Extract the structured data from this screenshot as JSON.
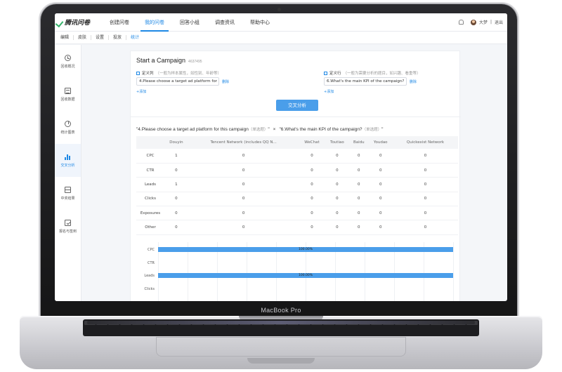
{
  "device": {
    "label": "MacBook Pro"
  },
  "header": {
    "logo_text": "腾讯问卷",
    "nav": [
      "创建问卷",
      "我的问卷",
      "回答小组",
      "调查资讯",
      "帮助中心"
    ],
    "active_nav": 1,
    "user_name": "大梦",
    "logout_label": "退出"
  },
  "subnav": {
    "items": [
      "编辑",
      "皮肤",
      "设置",
      "投放",
      "统计"
    ],
    "active": 4
  },
  "sidebar": {
    "items": [
      {
        "label": "回收概况",
        "icon": "clock-icon"
      },
      {
        "label": "回收数据",
        "icon": "document-icon"
      },
      {
        "label": "统计图表",
        "icon": "pie-chart-icon"
      },
      {
        "label": "交叉分析",
        "icon": "bar-chart-icon"
      },
      {
        "label": "中奖结果",
        "icon": "gift-icon"
      },
      {
        "label": "报名与签到",
        "icon": "signup-icon"
      }
    ],
    "active": 3
  },
  "survey": {
    "title": "Start a Campaign",
    "id": "4637495",
    "custom_col_label": "定义列",
    "custom_col_hint": "（一般为样本属性，如性别、年龄等）",
    "custom_col_value": "4.Please choose a target ad platform for",
    "custom_row_label": "定义行",
    "custom_row_hint": "（一般为需要分析的题目，如兴趣、看重等）",
    "custom_row_value": "6.What's the main KPI of the campaign?",
    "delete_label": "删除",
    "add_label": "+添加",
    "cross_button": "交叉分析"
  },
  "crosstab": {
    "q1": "\"4.Please choose a target ad platform for this campaign",
    "q1_tag": "（单选题）",
    "q1_end": "\"",
    "times": "×",
    "q2": "\"6.What's the main KPI of the campaign?",
    "q2_tag": "（单选题）",
    "q2_end": "\"",
    "columns": [
      "",
      "Douyin",
      "Tencent Network (includes QQ N...",
      "WeChat",
      "Toutiao",
      "Baidu",
      "Youdao",
      "Quickexist Network"
    ],
    "rows": [
      [
        "CPC",
        "1",
        "0",
        "0",
        "0",
        "0",
        "0",
        "0"
      ],
      [
        "CTR",
        "0",
        "0",
        "0",
        "0",
        "0",
        "0",
        "0"
      ],
      [
        "Leads",
        "1",
        "0",
        "0",
        "0",
        "0",
        "0",
        "0"
      ],
      [
        "Clicks",
        "0",
        "0",
        "0",
        "0",
        "0",
        "0",
        "0"
      ],
      [
        "Exposures",
        "0",
        "0",
        "0",
        "0",
        "0",
        "0",
        "0"
      ],
      [
        "Other",
        "0",
        "0",
        "0",
        "0",
        "0",
        "0",
        "0"
      ]
    ]
  },
  "chart_data": {
    "type": "bar",
    "orientation": "horizontal",
    "categories": [
      "CPC",
      "CTR",
      "Leads",
      "Clicks"
    ],
    "values": [
      100,
      0,
      100,
      0
    ],
    "value_labels": [
      "100.00%",
      "",
      "100.00%",
      ""
    ],
    "xlim": [
      0,
      100
    ],
    "grid": true,
    "colors": {
      "bar": "#4a9eea"
    }
  }
}
